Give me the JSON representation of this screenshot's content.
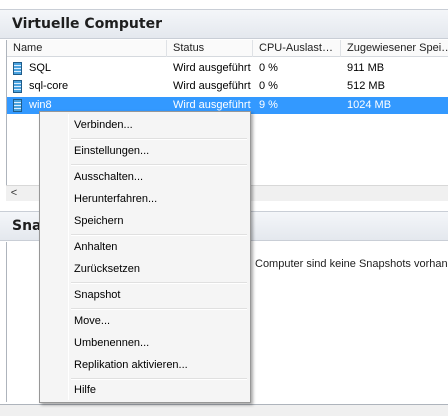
{
  "vm_panel": {
    "title": "Virtuelle Computer",
    "columns": [
      "Name",
      "Status",
      "CPU-Auslast…",
      "Zugewiesener Spei…"
    ],
    "rows": [
      {
        "name": "SQL",
        "status": "",
        "cpu": "",
        "memory": "911 MB"
      },
      {
        "name": "sql-core",
        "status": "Wird ausgeführt",
        "cpu": "0 %",
        "memory": "512 MB"
      },
      {
        "name": "win8",
        "status": "Wird ausgeführt",
        "cpu": "9 %",
        "memory": "1024 MB"
      }
    ],
    "row0_status": "Wird ausgeführt",
    "row0_cpu": "0 %",
    "selected_row": "win8",
    "scroll_left_glyph": "<"
  },
  "snapshot_panel": {
    "title": "Snapshots",
    "title_visible": "Sna",
    "message": "Computer sind keine Snapshots vorhande"
  },
  "context_menu": {
    "items": [
      "Verbinden...",
      "Einstellungen...",
      "Ausschalten...",
      "Herunterfahren...",
      "Speichern",
      "Anhalten",
      "Zurücksetzen",
      "Snapshot",
      "Move...",
      "Umbenennen...",
      "Replikation aktivieren...",
      "Hilfe"
    ]
  },
  "colors": {
    "selection": "#3399ff",
    "header_bg": "#e4e8ee",
    "menu_bg": "#f5f5f5"
  },
  "icons": {
    "vm": "virtual-machine-icon",
    "scroll_left": "chevron-left-icon"
  }
}
